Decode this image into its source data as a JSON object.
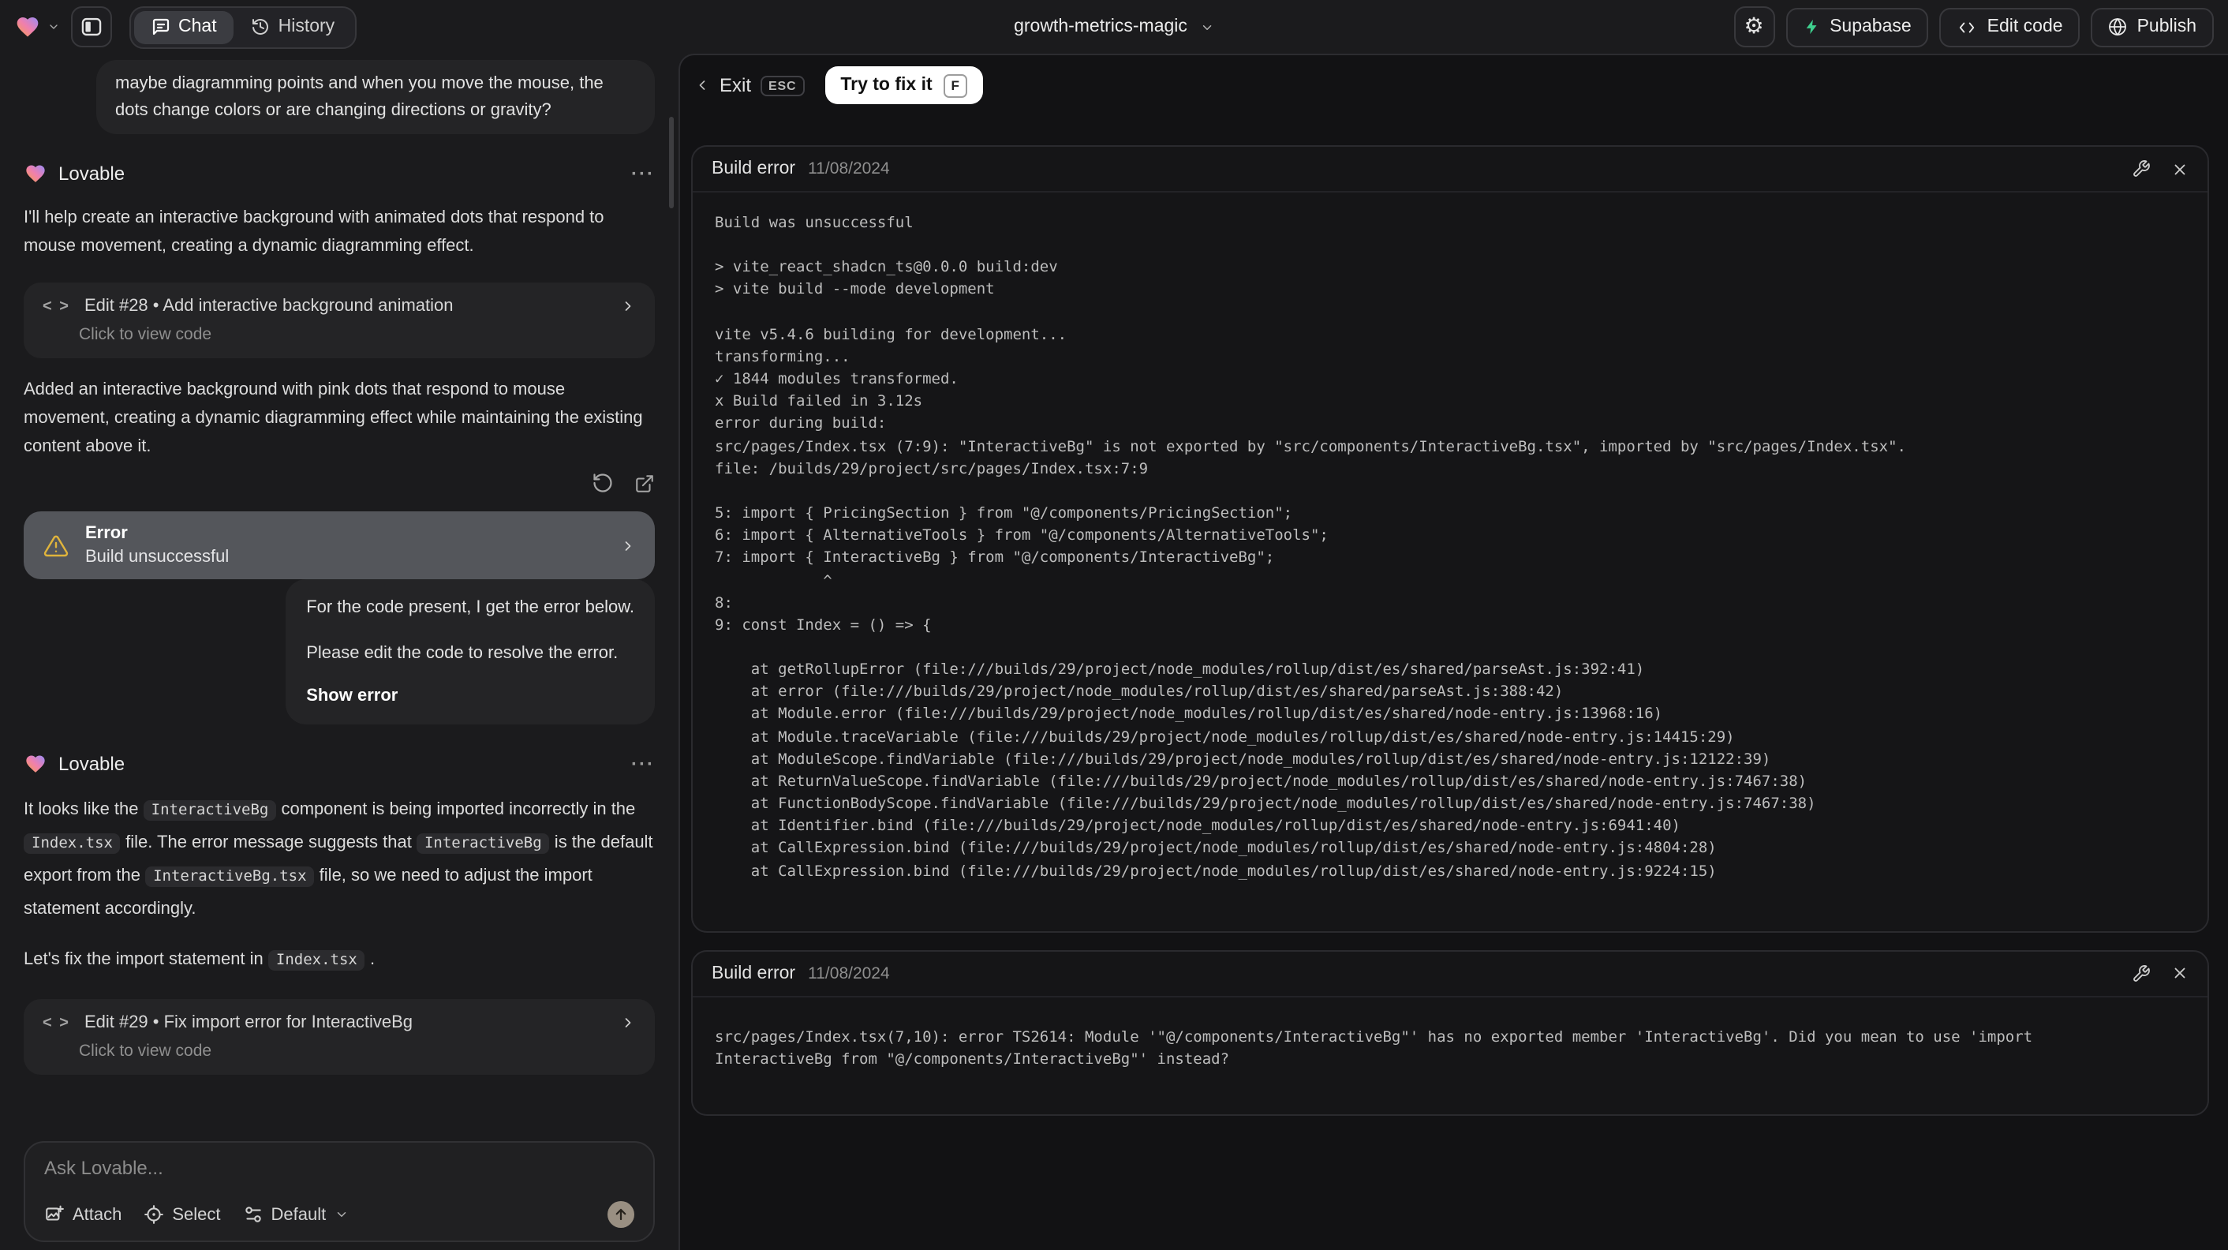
{
  "topbar": {
    "project_name": "growth-metrics-magic",
    "tab_chat": "Chat",
    "tab_history": "History",
    "supabase_label": "Supabase",
    "edit_code_label": "Edit code",
    "publish_label": "Publish",
    "gear_glyph": "⚙"
  },
  "chat": {
    "user_message_1": "maybe diagramming points and when you move the mouse, the dots change colors or are changing directions or gravity?",
    "assistant_name": "Lovable",
    "more_label": "···",
    "message_1": "I'll help create an interactive background with animated dots that respond to mouse movement, creating a dynamic diagramming effect.",
    "edit_card_28": {
      "icon": "< >",
      "title": "Edit #28 • Add interactive background animation",
      "subtitle": "Click to view code"
    },
    "message_2": "Added an interactive background with pink dots that respond to mouse movement, creating a dynamic diagramming effect while maintaining the existing content above it.",
    "error_card": {
      "title": "Error",
      "subtitle": "Build unsuccessful"
    },
    "user_message_2": {
      "line1": "For the code present, I get the error below.",
      "line2": "Please edit the code to resolve the error.",
      "action": "Show error"
    },
    "message_3": {
      "t1": "It looks like the ",
      "c1": "InteractiveBg",
      "t2": " component is being imported incorrectly in the ",
      "c2": "Index.tsx",
      "t3": " file. The error message suggests that ",
      "c3": "InteractiveBg",
      "t4": " is the default export from the ",
      "c4": "InteractiveBg.tsx",
      "t5": " file, so we need to adjust the import statement accordingly."
    },
    "message_4": {
      "t1": "Let's fix the import statement in ",
      "c1": "Index.tsx",
      "t2": " ."
    },
    "edit_card_29": {
      "icon": "< >",
      "title": "Edit #29 • Fix import error for InteractiveBg",
      "subtitle": "Click to view code"
    },
    "composer": {
      "placeholder": "Ask Lovable...",
      "attach": "Attach",
      "select": "Select",
      "mode": "Default"
    }
  },
  "error_view": {
    "exit_label": "Exit",
    "esc_key": "ESC",
    "fix_button": "Try to fix it",
    "fix_key": "F",
    "cards": [
      {
        "title": "Build error",
        "date": "11/08/2024",
        "log": "Build was unsuccessful\n\n> vite_react_shadcn_ts@0.0.0 build:dev\n> vite build --mode development\n\nvite v5.4.6 building for development...\ntransforming...\n✓ 1844 modules transformed.\nx Build failed in 3.12s\nerror during build:\nsrc/pages/Index.tsx (7:9): \"InteractiveBg\" is not exported by \"src/components/InteractiveBg.tsx\", imported by \"src/pages/Index.tsx\".\nfile: /builds/29/project/src/pages/Index.tsx:7:9\n\n5: import { PricingSection } from \"@/components/PricingSection\";\n6: import { AlternativeTools } from \"@/components/AlternativeTools\";\n7: import { InteractiveBg } from \"@/components/InteractiveBg\";\n            ^\n8: \n9: const Index = () => {\n\n    at getRollupError (file:///builds/29/project/node_modules/rollup/dist/es/shared/parseAst.js:392:41)\n    at error (file:///builds/29/project/node_modules/rollup/dist/es/shared/parseAst.js:388:42)\n    at Module.error (file:///builds/29/project/node_modules/rollup/dist/es/shared/node-entry.js:13968:16)\n    at Module.traceVariable (file:///builds/29/project/node_modules/rollup/dist/es/shared/node-entry.js:14415:29)\n    at ModuleScope.findVariable (file:///builds/29/project/node_modules/rollup/dist/es/shared/node-entry.js:12122:39)\n    at ReturnValueScope.findVariable (file:///builds/29/project/node_modules/rollup/dist/es/shared/node-entry.js:7467:38)\n    at FunctionBodyScope.findVariable (file:///builds/29/project/node_modules/rollup/dist/es/shared/node-entry.js:7467:38)\n    at Identifier.bind (file:///builds/29/project/node_modules/rollup/dist/es/shared/node-entry.js:6941:40)\n    at CallExpression.bind (file:///builds/29/project/node_modules/rollup/dist/es/shared/node-entry.js:4804:28)\n    at CallExpression.bind (file:///builds/29/project/node_modules/rollup/dist/es/shared/node-entry.js:9224:15)"
      },
      {
        "title": "Build error",
        "date": "11/08/2024",
        "log": "src/pages/Index.tsx(7,10): error TS2614: Module '\"@/components/InteractiveBg\"' has no exported member 'InteractiveBg'. Did you mean to use 'import\nInteractiveBg from \"@/components/InteractiveBg\"' instead?"
      }
    ]
  },
  "colors": {
    "supabase_green": "#3ecf8e",
    "warning_amber": "#e0b43c",
    "fix_button_bg": "#ffffff",
    "error_card_bg": "#54565b",
    "send_button_bg": "#998f82",
    "heart_gradient": [
      "#f6a14b",
      "#ef7fae",
      "#9a8cf5"
    ]
  }
}
